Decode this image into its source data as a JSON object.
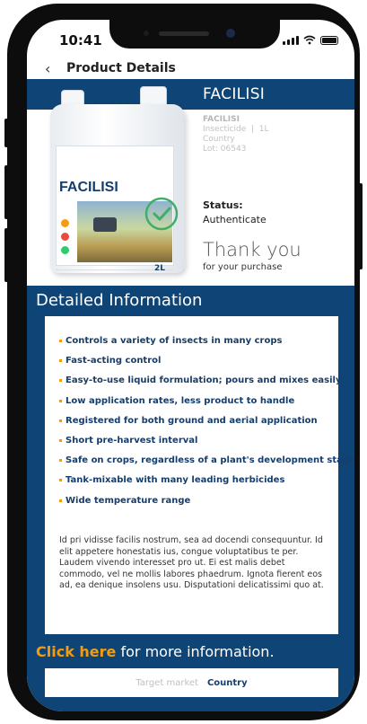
{
  "status_bar": {
    "time": "10:41"
  },
  "nav": {
    "title": "Product Details"
  },
  "product": {
    "title": "FACILISI",
    "image_brand": "FACILISI",
    "image_size": "2L",
    "name": "FACILISI",
    "type_line": "Insecticide  |  1L",
    "country": "Country",
    "lot": "Lot: 06543"
  },
  "status": {
    "label": "Status:",
    "value": "Authenticate"
  },
  "thanks": {
    "headline": "Thank you",
    "subline": "for your purchase"
  },
  "details": {
    "title": "Detailed Information",
    "features": [
      "Controls a variety of insects in many crops",
      "Fast-acting control",
      "Easy-to-use liquid formulation; pours and mixes easily",
      "Low application rates, less product to handle",
      "Registered for both ground and aerial application",
      "Short pre-harvest interval",
      "Safe on crops, regardless of a plant's development stage",
      "Tank-mixable with many leading herbicides",
      "Wide temperature range"
    ],
    "description": "Id pri vidisse facilis nostrum, sea ad docendi consequuntur. Id elit appetere honestatis ius, congue voluptatibus te per. Laudem vivendo interesset pro ut. Ei est malis debet commodo, vel ne mollis labores phaedrum. Ignota fierent eos ad, ea denique insolens usu. Disputationi delicatissimi quo at."
  },
  "cta": {
    "link": "Click here",
    "rest": " for more information."
  },
  "market": {
    "label": "Target market",
    "value": "Country"
  },
  "colors": {
    "brand_blue": "#0f4576",
    "accent_orange": "#f39c12",
    "check_green": "#3fae6a"
  }
}
